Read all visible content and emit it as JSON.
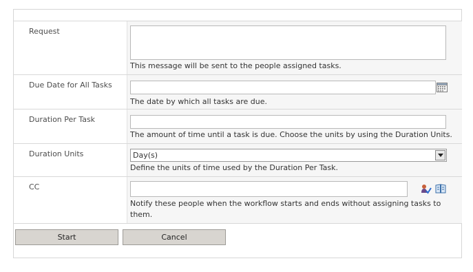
{
  "form": {
    "request": {
      "label": "Request",
      "value": "",
      "description": "This message will be sent to the people assigned tasks."
    },
    "due_date": {
      "label": "Due Date for All Tasks",
      "value": "",
      "description": "The date by which all tasks are due.",
      "icon": "calendar-icon"
    },
    "duration_per_task": {
      "label": "Duration Per Task",
      "value": "",
      "description": "The amount of time until a task is due. Choose the units by using the Duration Units."
    },
    "duration_units": {
      "label": "Duration Units",
      "selected": "Day(s)",
      "description": "Define the units of time used by the Duration Per Task."
    },
    "cc": {
      "label": "CC",
      "value": "",
      "description_line1": "Notify these people when the workflow starts and ends without assigning tasks to",
      "description_line2": "them.",
      "icons": [
        "check-names-icon",
        "address-book-icon"
      ]
    }
  },
  "buttons": {
    "start_label": "Start",
    "cancel_label": "Cancel"
  },
  "colors": {
    "row_background": "#f6f6f6",
    "button_background": "#d8d5d0",
    "border": "#d6d6d6"
  }
}
